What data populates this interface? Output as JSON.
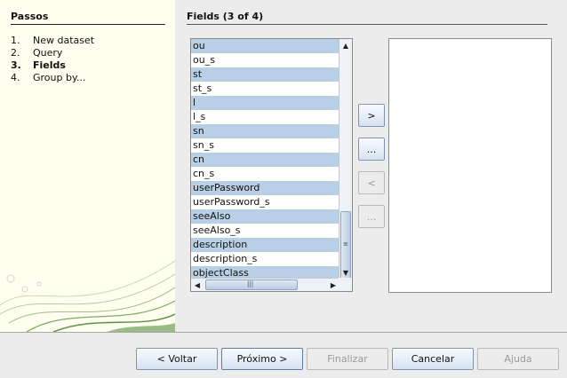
{
  "sidebar": {
    "title": "Passos",
    "steps": [
      {
        "num": "1.",
        "label": "New dataset"
      },
      {
        "num": "2.",
        "label": "Query"
      },
      {
        "num": "3.",
        "label": "Fields"
      },
      {
        "num": "4.",
        "label": "Group by..."
      }
    ]
  },
  "main": {
    "title": "Fields  (3 of 4)",
    "field_list": {
      "items": [
        {
          "label": "ou",
          "selected": true
        },
        {
          "label": "ou_s",
          "selected": false
        },
        {
          "label": "st",
          "selected": true
        },
        {
          "label": "st_s",
          "selected": false
        },
        {
          "label": "l",
          "selected": true
        },
        {
          "label": "l_s",
          "selected": false
        },
        {
          "label": "sn",
          "selected": true
        },
        {
          "label": "sn_s",
          "selected": false
        },
        {
          "label": "cn",
          "selected": true
        },
        {
          "label": "cn_s",
          "selected": false
        },
        {
          "label": "userPassword",
          "selected": true
        },
        {
          "label": "userPassword_s",
          "selected": false
        },
        {
          "label": "seeAlso",
          "selected": true
        },
        {
          "label": "seeAlso_s",
          "selected": false
        },
        {
          "label": "description",
          "selected": true
        },
        {
          "label": "description_s",
          "selected": false
        },
        {
          "label": "objectClass",
          "selected": true
        }
      ]
    },
    "transfer_buttons": {
      "add": ">",
      "add_all": "...",
      "remove": "<",
      "remove_all": "..."
    }
  },
  "footer": {
    "back": "< Voltar",
    "next": "Próximo >",
    "finish": "Finalizar",
    "cancel": "Cancelar",
    "help": "Ajuda"
  }
}
